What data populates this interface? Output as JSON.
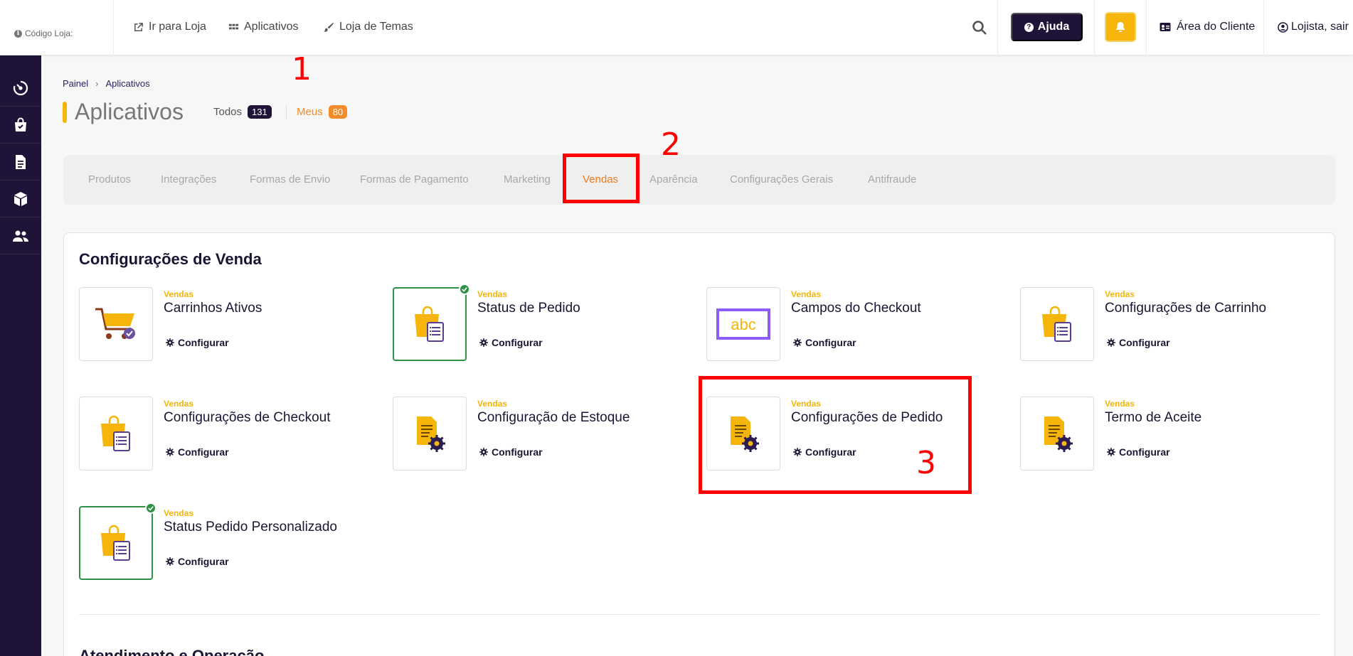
{
  "topbar": {
    "store_code_label": "Código Loja:",
    "nav": [
      {
        "label": "Ir para Loja",
        "icon": "external-link-icon"
      },
      {
        "label": "Aplicativos",
        "icon": "grid-icon"
      },
      {
        "label": "Loja de Temas",
        "icon": "brush-icon"
      }
    ],
    "help_label": "Ajuda",
    "client_area_label": "Área do Cliente",
    "logout_label": "Lojista, sair"
  },
  "sidebar": {
    "icons": [
      "dashboard-icon",
      "shopping-bag-icon",
      "document-icon",
      "box-icon",
      "users-icon"
    ]
  },
  "breadcrumb": [
    "Painel",
    "Aplicativos"
  ],
  "page": {
    "title": "Aplicativos",
    "filters": [
      {
        "label": "Todos",
        "count": "131",
        "color": "#1f1437"
      },
      {
        "label": "Meus",
        "count": "80",
        "color": "#f28c28"
      }
    ]
  },
  "tabs": [
    {
      "label": "Produtos",
      "active": false
    },
    {
      "label": "Integrações",
      "active": false
    },
    {
      "label": "Formas de Envio",
      "active": false
    },
    {
      "label": "Formas de Pagamento",
      "active": false
    },
    {
      "label": "Marketing",
      "active": false
    },
    {
      "label": "Vendas",
      "active": true
    },
    {
      "label": "Aparência",
      "active": false
    },
    {
      "label": "Configurações Gerais",
      "active": false
    },
    {
      "label": "Antifraude",
      "active": false
    }
  ],
  "section": {
    "title": "Configurações de Venda",
    "config_label": "Configurar",
    "apps": [
      {
        "category": "Vendas",
        "name": "Carrinhos Ativos",
        "icon": "cart-icon",
        "installed": false
      },
      {
        "category": "Vendas",
        "name": "Status de Pedido",
        "icon": "bag-list-icon",
        "installed": true
      },
      {
        "category": "Vendas",
        "name": "Campos do Checkout",
        "icon": "abc-field-icon",
        "installed": false
      },
      {
        "category": "Vendas",
        "name": "Configurações de Carrinho",
        "icon": "bag-list-icon",
        "installed": false
      },
      {
        "category": "Vendas",
        "name": "Configurações de Checkout",
        "icon": "bag-list-icon",
        "installed": false
      },
      {
        "category": "Vendas",
        "name": "Configuração de Estoque",
        "icon": "doc-gear-icon",
        "installed": false
      },
      {
        "category": "Vendas",
        "name": "Configurações de Pedido",
        "icon": "doc-gear-icon",
        "installed": false
      },
      {
        "category": "Vendas",
        "name": "Termo de Aceite",
        "icon": "doc-gear-icon",
        "installed": false
      },
      {
        "category": "Vendas",
        "name": "Status Pedido Personalizado",
        "icon": "bag-list-icon",
        "installed": true
      }
    ]
  },
  "next_section_title": "Atendimento e Operação",
  "annotations": [
    "1",
    "2",
    "3"
  ],
  "colors": {
    "brand_dark": "#1f1437",
    "accent_yellow": "#f5b50a",
    "accent_orange": "#f27a1a",
    "installed_green": "#2f9146",
    "annotation_red": "#ff0000"
  }
}
